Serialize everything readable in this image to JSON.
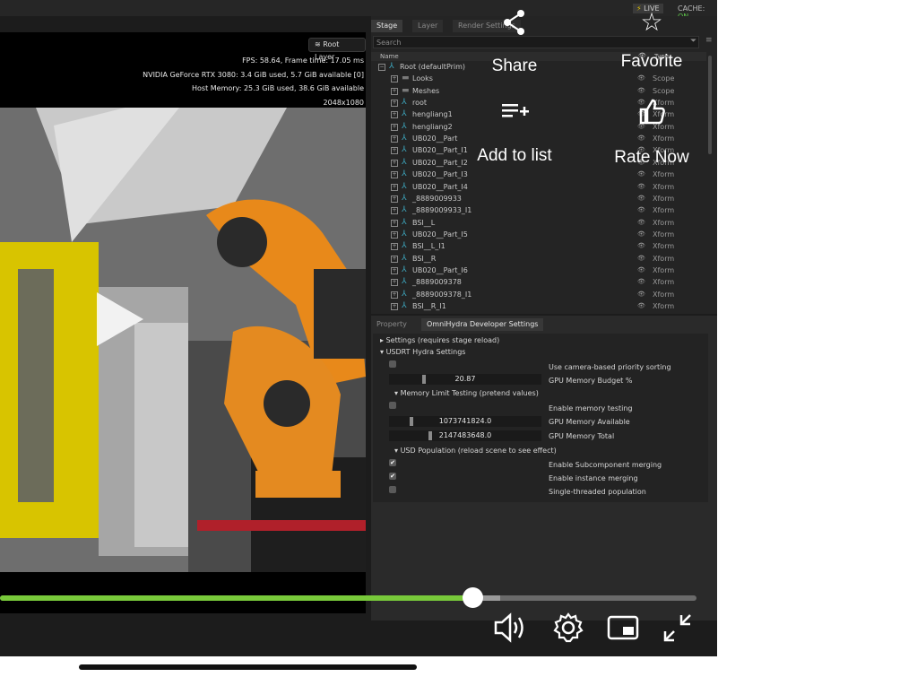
{
  "status": {
    "live": "LIVE",
    "cache_label": "CACHE:",
    "cache_value": "ON"
  },
  "viewport": {
    "root_layer": "Root Layer",
    "stats": [
      "FPS: 58.64, Frame time: 17.05 ms",
      "NVIDIA GeForce RTX 3080: 3.4 GiB used,  5.7 GiB available [0]",
      "Host Memory: 25.3 GiB used, 38.6 GiB available",
      "2048x1080"
    ]
  },
  "stage": {
    "tabs": [
      "Stage",
      "Layer",
      "Render Settings"
    ],
    "search_placeholder": "Search",
    "col_name": "Name",
    "col_type": "Type",
    "rows": [
      {
        "name": "Root (defaultPrim)",
        "type": "",
        "icon": "xform",
        "depth": 0,
        "expander": "−"
      },
      {
        "name": "Looks",
        "type": "Scope",
        "icon": "folder",
        "depth": 1,
        "expander": "+"
      },
      {
        "name": "Meshes",
        "type": "Scope",
        "icon": "folder",
        "depth": 1,
        "expander": "+"
      },
      {
        "name": "root",
        "type": "Xform",
        "icon": "xform",
        "depth": 1,
        "expander": "+"
      },
      {
        "name": "hengliang1",
        "type": "Xform",
        "icon": "xform",
        "depth": 1,
        "expander": "+"
      },
      {
        "name": "hengliang2",
        "type": "Xform",
        "icon": "xform",
        "depth": 1,
        "expander": "+"
      },
      {
        "name": "UB020__Part",
        "type": "Xform",
        "icon": "xform",
        "depth": 1,
        "expander": "+"
      },
      {
        "name": "UB020__Part_I1",
        "type": "Xform",
        "icon": "xform",
        "depth": 1,
        "expander": "+"
      },
      {
        "name": "UB020__Part_I2",
        "type": "Xform",
        "icon": "xform",
        "depth": 1,
        "expander": "+"
      },
      {
        "name": "UB020__Part_I3",
        "type": "Xform",
        "icon": "xform",
        "depth": 1,
        "expander": "+"
      },
      {
        "name": "UB020__Part_I4",
        "type": "Xform",
        "icon": "xform",
        "depth": 1,
        "expander": "+"
      },
      {
        "name": "_8889009933",
        "type": "Xform",
        "icon": "xform",
        "depth": 1,
        "expander": "+"
      },
      {
        "name": "_8889009933_I1",
        "type": "Xform",
        "icon": "xform",
        "depth": 1,
        "expander": "+"
      },
      {
        "name": "BSI__L",
        "type": "Xform",
        "icon": "xform",
        "depth": 1,
        "expander": "+"
      },
      {
        "name": "UB020__Part_I5",
        "type": "Xform",
        "icon": "xform",
        "depth": 1,
        "expander": "+"
      },
      {
        "name": "BSI__L_I1",
        "type": "Xform",
        "icon": "xform",
        "depth": 1,
        "expander": "+"
      },
      {
        "name": "BSI__R",
        "type": "Xform",
        "icon": "xform",
        "depth": 1,
        "expander": "+"
      },
      {
        "name": "UB020__Part_I6",
        "type": "Xform",
        "icon": "xform",
        "depth": 1,
        "expander": "+"
      },
      {
        "name": "_8889009378",
        "type": "Xform",
        "icon": "xform",
        "depth": 1,
        "expander": "+"
      },
      {
        "name": "_8889009378_I1",
        "type": "Xform",
        "icon": "xform",
        "depth": 1,
        "expander": "+"
      },
      {
        "name": "BSI__R_I1",
        "type": "Xform",
        "icon": "xform",
        "depth": 1,
        "expander": "+"
      }
    ]
  },
  "props": {
    "tabs": [
      "Property",
      "OmniHydra Developer Settings"
    ],
    "settings_header": "Settings (requires stage reload)",
    "usdrt_header": "USDRT Hydra Settings",
    "camera_priority": "Use camera-based priority sorting",
    "gpu_budget_value": "20.87",
    "gpu_budget_label": "GPU Memory Budget %",
    "mem_limit_header": "Memory Limit Testing (pretend values)",
    "enable_mem_testing": "Enable memory testing",
    "gpu_avail_value": "1073741824.0",
    "gpu_avail_label": "GPU Memory Available",
    "gpu_total_value": "2147483648.0",
    "gpu_total_label": "GPU Memory Total",
    "usd_pop_header": "USD Population (reload scene to see effect)",
    "subcomponent_merging": "Enable Subcomponent merging",
    "instance_merging": "Enable instance merging",
    "single_threaded": "Single-threaded population",
    "checked": {
      "camera_priority": false,
      "mem_testing": false,
      "subcomponent": true,
      "instance": true,
      "single_threaded": false
    }
  },
  "overlay": {
    "share": "Share",
    "favorite": "Favorite",
    "add_to_list": "Add to list",
    "rate_now": "Rate Now"
  },
  "player": {
    "progress": 0.678,
    "buffered": 0.718,
    "accent": "#78c93a"
  }
}
